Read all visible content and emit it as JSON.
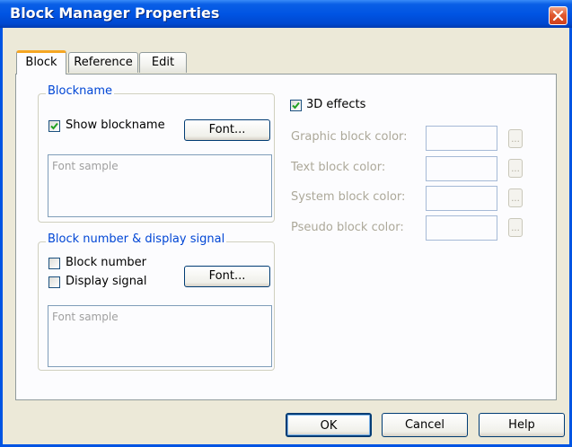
{
  "window": {
    "title": "Block Manager Properties",
    "close_icon": "close-icon"
  },
  "tabs": [
    {
      "label": "Block",
      "active": true
    },
    {
      "label": "Reference",
      "active": false
    },
    {
      "label": "Edit",
      "active": false
    }
  ],
  "blockname_group": {
    "legend": "Blockname",
    "show_blockname": {
      "label": "Show blockname",
      "checked": true
    },
    "font_button": "Font...",
    "font_sample": "Font sample"
  },
  "blocknumber_group": {
    "legend": "Block number & display signal",
    "block_number": {
      "label": "Block number",
      "checked": false
    },
    "display_signal": {
      "label": "Display signal",
      "checked": false
    },
    "font_button": "Font...",
    "font_sample": "Font sample"
  },
  "effects": {
    "label": "3D effects",
    "checked": true
  },
  "colors": [
    {
      "label": "Graphic block color:",
      "button": "..."
    },
    {
      "label": "Text block color:",
      "button": "..."
    },
    {
      "label": "System block color:",
      "button": "..."
    },
    {
      "label": "Pseudo block color:",
      "button": "..."
    }
  ],
  "buttons": {
    "ok": "OK",
    "cancel": "Cancel",
    "help": "Help"
  },
  "theme": {
    "title_blue": "#0054e3",
    "group_legend_blue": "#0046d5",
    "tab_accent": "#f5a623",
    "close_red": "#e0582e"
  }
}
